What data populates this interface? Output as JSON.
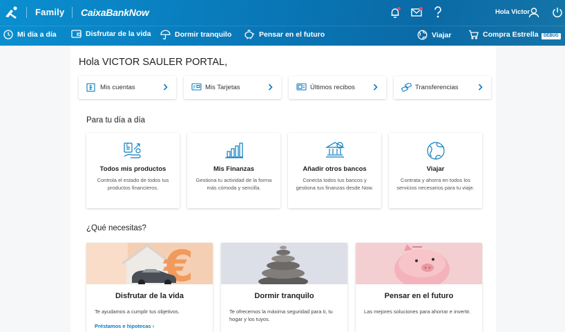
{
  "header": {
    "brand_family": "Family",
    "brand_now": "CaixaBankNow",
    "greeting": "Hola Victor",
    "icons": [
      "bell-icon",
      "mail-icon",
      "help-icon",
      "user-icon",
      "power-icon"
    ]
  },
  "nav": {
    "items": [
      {
        "label": "Mi día a día",
        "icon": "clock-icon"
      },
      {
        "label": "Disfrutar de la vida",
        "icon": "wallet-icon"
      },
      {
        "label": "Dormir tranquilo",
        "icon": "umbrella-icon"
      },
      {
        "label": "Pensar en el futuro",
        "icon": "piggy-icon"
      },
      {
        "label": "Viajar",
        "icon": "globe-icon"
      },
      {
        "label": "Compra Estrella",
        "icon": "cart-icon"
      }
    ],
    "debug": "DEBUG"
  },
  "main": {
    "greeting": "Hola VICTOR SAULER PORTAL,",
    "quick_links": [
      {
        "label": "Mis cuentas",
        "icon": "accounts-icon"
      },
      {
        "label": "Mis Tarjetas",
        "icon": "card-icon"
      },
      {
        "label": "Últimos recibos",
        "icon": "receipt-icon"
      },
      {
        "label": "Transferencias",
        "icon": "transfer-icon"
      }
    ],
    "daily_title": "Para tu día a día",
    "daily_cards": [
      {
        "title": "Todos mis productos",
        "desc": "Controla el estado de todos tus productos financieros.",
        "icon": "products-icon"
      },
      {
        "title": "Mis Finanzas",
        "desc": "Gestiona tu actividad de la forma más cómoda y sencilla.",
        "icon": "bar-chart-icon"
      },
      {
        "title": "Añadir otros bancos",
        "desc": "Conecta todos tus bancos y gestiona tus finanzas desde Now.",
        "icon": "bank-icon"
      },
      {
        "title": "Viajar",
        "desc": "Contrata y ahorra en todos los servicios necesarios para tu viaje.",
        "icon": "globe-icon"
      }
    ],
    "needs_title": "¿Qué necesitas?",
    "needs_cards": [
      {
        "title": "Disfrutar de la vida",
        "desc": "Te ayudamos a cumplir tus objetivos.",
        "link": "Préstamos e hipotecas"
      },
      {
        "title": "Dormir tranquilo",
        "desc": "Te ofrecemos la máxima seguridad para ti, tu hogar y los tuyos.",
        "link": ""
      },
      {
        "title": "Pensar en el futuro",
        "desc": "Las mejores soluciones para ahorrar e invertir.",
        "link": ""
      }
    ]
  },
  "colors": {
    "brand_blue": "#0a7cbf",
    "header_start": "#0a8fd0",
    "header_end": "#0a6aa6",
    "notification": "#e8475c"
  }
}
